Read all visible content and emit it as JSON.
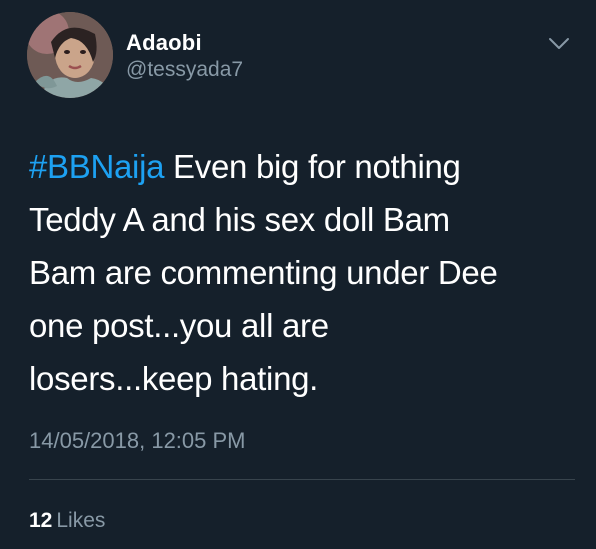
{
  "tweet": {
    "author": {
      "display_name": "Adaobi",
      "handle": "@tessyada7",
      "avatar_icon": "profile-photo"
    },
    "menu_icon": "chevron-down-icon",
    "text": {
      "hashtag": "#BBNaija",
      "line1_rest": " Even big for nothing",
      "line2": "Teddy A and his sex doll Bam",
      "line3": "Bam are commenting under Dee",
      "line4": "one post...you all are",
      "line5": "losers...keep hating."
    },
    "timestamp": "14/05/2018, 12:05 PM",
    "likes": {
      "count": "12",
      "label": "Likes"
    }
  },
  "colors": {
    "background": "#15202b",
    "text": "#ffffff",
    "secondary_text": "#8899a6",
    "link": "#1da1f2",
    "divider": "#38444d"
  }
}
